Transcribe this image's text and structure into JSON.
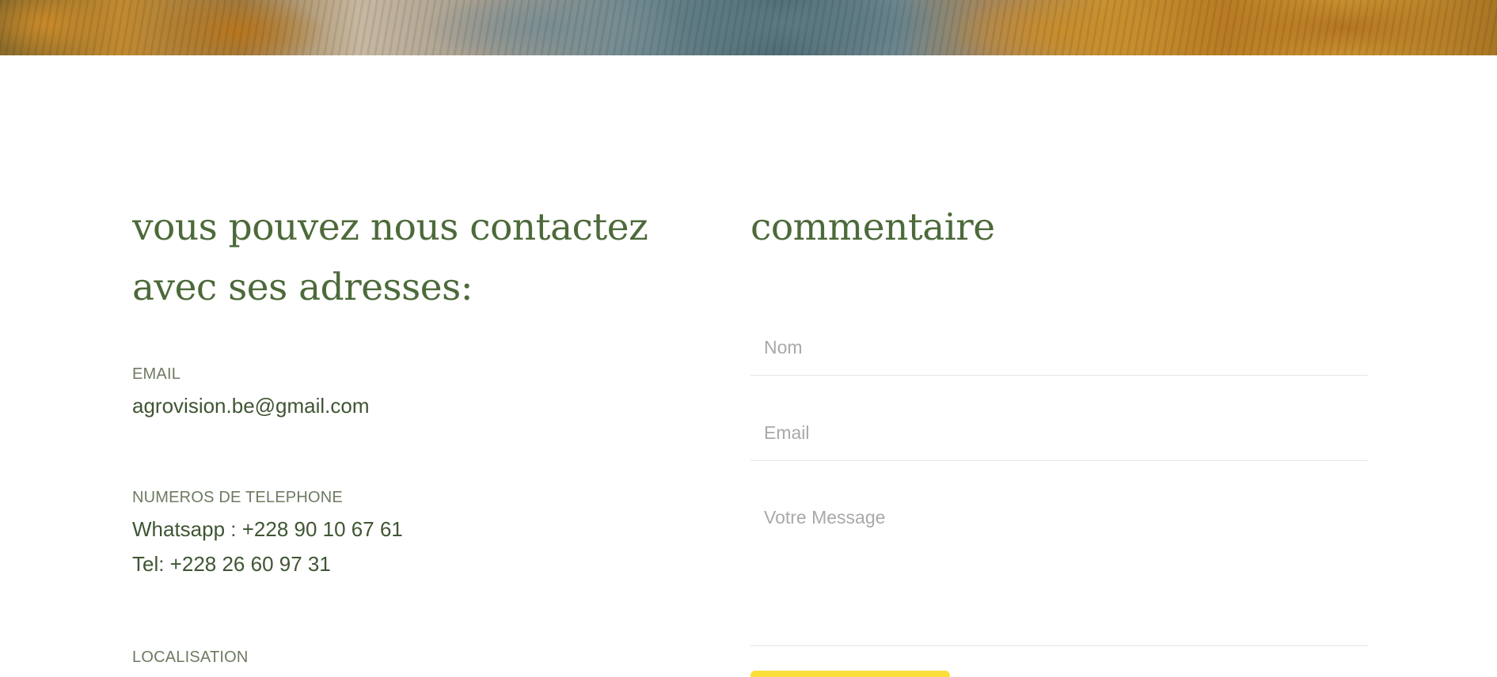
{
  "hero": {
    "image_description_icon": "landscape-photo"
  },
  "contact": {
    "heading": "vous pouvez nous contactez avec ses adresses:",
    "email": {
      "label": "EMAIL",
      "value": "agrovision.be@gmail.com"
    },
    "phone": {
      "label": "NUMEROS DE TELEPHONE",
      "whatsapp": "Whatsapp : +228 90 10 67 61",
      "tel": "Tel: +228 26 60 97 31"
    },
    "location": {
      "label": "LOCALISATION"
    }
  },
  "comment_form": {
    "heading": "commentaire",
    "name_placeholder": "Nom",
    "email_placeholder": "Email",
    "message_placeholder": "Votre Message",
    "submit_label": ""
  },
  "colors": {
    "heading": "#4d6a3a",
    "text": "#3f5533",
    "label": "#6d7a62",
    "button": "#fadf3b",
    "placeholder": "#a9a9a9"
  }
}
